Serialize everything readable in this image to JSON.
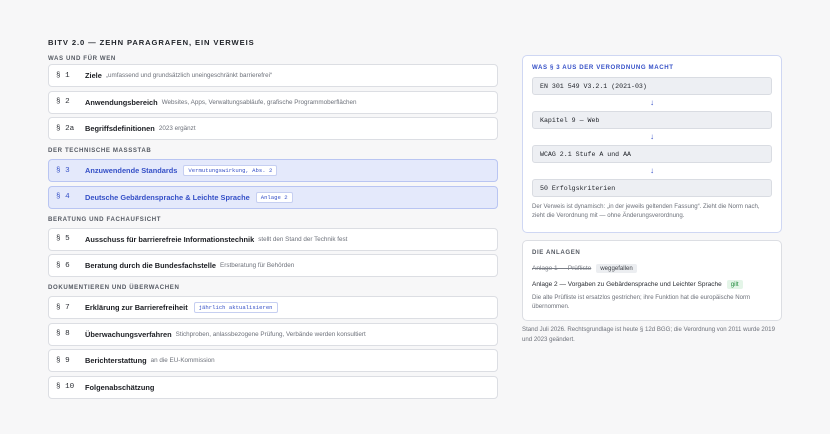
{
  "page_title": "BITV 2.0 — ZEHN PARAGRAFEN, EIN VERWEIS",
  "sections": [
    {
      "heading": "WAS UND FÜR WEN",
      "items": [
        {
          "num": "§ 1",
          "title": "Ziele",
          "desc": "„umfassend und grundsätzlich uneingeschränkt barrierefrei“"
        },
        {
          "num": "§ 2",
          "title": "Anwendungsbereich",
          "desc": "Websites, Apps, Verwaltungsabläufe, grafische Programmoberflächen"
        },
        {
          "num": "§ 2a",
          "title": "Begriffsdefinitionen",
          "desc": "2023 ergänzt"
        }
      ]
    },
    {
      "heading": "DER TECHNISCHE MASSSTAB",
      "items": [
        {
          "num": "§ 3",
          "title": "Anzuwendende Standards",
          "tag": "Vermutungswirkung, Abs. 2"
        },
        {
          "num": "§ 4",
          "title": "Deutsche Gebärdensprache & Leichte Sprache",
          "tag": "Anlage 2"
        }
      ]
    },
    {
      "heading": "BERATUNG UND FACHAUFSICHT",
      "items": [
        {
          "num": "§ 5",
          "title": "Ausschuss für barrierefreie Informationstechnik",
          "desc": "stellt den Stand der Technik fest"
        },
        {
          "num": "§ 6",
          "title": "Beratung durch die Bundesfachstelle",
          "desc": "Erstberatung für Behörden"
        }
      ]
    },
    {
      "heading": "DOKUMENTIEREN UND ÜBERWACHEN",
      "items": [
        {
          "num": "§ 7",
          "title": "Erklärung zur Barrierefreiheit",
          "tag": "jährlich aktualisieren"
        },
        {
          "num": "§ 8",
          "title": "Überwachungsverfahren",
          "desc": "Stichproben, anlassbezogene Prüfung, Verbände werden konsultiert"
        },
        {
          "num": "§ 9",
          "title": "Berichterstattung",
          "desc": "an die EU-Kommission"
        },
        {
          "num": "§ 10",
          "title": "Folgenabschätzung",
          "desc": ""
        }
      ]
    }
  ],
  "verweis_card": {
    "heading": "WAS § 3 AUS DER VERORDNUNG MACHT",
    "chain": [
      "EN 301 549 V3.2.1 (2021-03)",
      "Kapitel 9 — Web",
      "WCAG 2.1 Stufe A und AA",
      "50 Erfolgskriterien"
    ],
    "arrow_icon": "↓",
    "note": "Der Verweis ist dynamisch: „in der jeweils geltenden Fassung“. Zieht die Norm nach, zieht die Verordnung mit — ohne Änderungsverordnung."
  },
  "anlagen_card": {
    "heading": "DIE ANLAGEN",
    "anlage1": {
      "text": "Anlage 1 — Prüfliste",
      "badge": "weggefallen"
    },
    "anlage2": {
      "text": "Anlage 2 — Vorgaben zu Gebärdensprache und Leichter Sprache",
      "badge": "gilt"
    },
    "note": "Die alte Prüfliste ist ersatzlos gestrichen; ihre Funktion hat die europäische Norm übernommen."
  },
  "status_text": "Stand Juli 2026. Rechtsgrundlage ist heute § 12d BGG; die Verordnung von 2011 wurde 2019 und 2023 geändert.",
  "colors": {
    "accent": "#3550c7",
    "highlight_bg": "#e4e9fb",
    "green": "#1f8a3b"
  }
}
